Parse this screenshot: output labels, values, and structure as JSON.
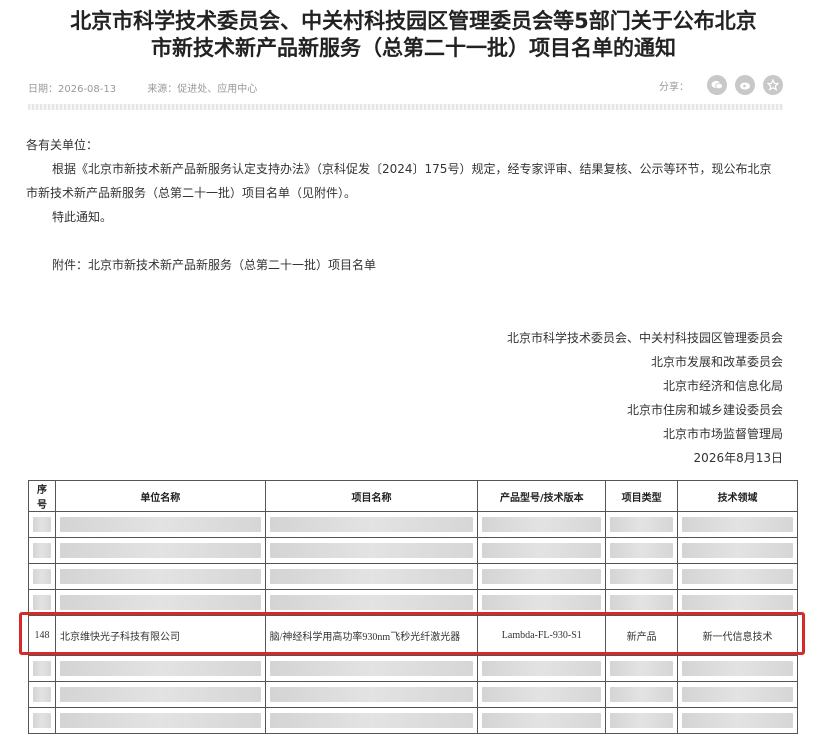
{
  "article": {
    "title_line1": "北京市科学技术委员会、中关村科技园区管理委员会等5部门关于公布北京",
    "title_line2": "市新技术新产品新服务（总第二十一批）项目名单的通知",
    "date": "日期：2026-08-13",
    "source": "来源：促进处、应用中心",
    "share_label": "分享：",
    "share_icons": [
      "wechat-icon",
      "weibo-icon",
      "favorite-icon"
    ]
  },
  "content": {
    "salutation": "各有关单位：",
    "para1_line1": "根据《北京市新技术新产品新服务认定支持办法》（京科促发〔2024〕175号）规定，经专家评审、结果复核、公示等环节，现公布北京",
    "para1_line2": "市新技术新产品新服务（总第二十一批）项目名单（见附件）。",
    "notice": "特此通知。",
    "attachment": "附件：北京市新技术新产品新服务（总第二十一批）项目名单"
  },
  "signatures": [
    "北京市科学技术委员会、中关村科技园区管理委员会",
    "北京市发展和改革委员会",
    "北京市经济和信息化局",
    "北京市住房和城乡建设委员会",
    "北京市市场监督管理局",
    "2026年8月13日"
  ],
  "table": {
    "headers": [
      "序号",
      "单位名称",
      "项目名称",
      "产品型号/技术版本",
      "项目类型",
      "技术领域"
    ],
    "highlighted_row": {
      "no": "148",
      "company": "北京维快光子科技有限公司",
      "project": "脑/神经科学用高功率930nm飞秒光纤激光器",
      "model": "Lambda-FL-930-S1",
      "type": "新产品",
      "field": "新一代信息技术"
    },
    "highlight_color": "#d42a2a"
  }
}
